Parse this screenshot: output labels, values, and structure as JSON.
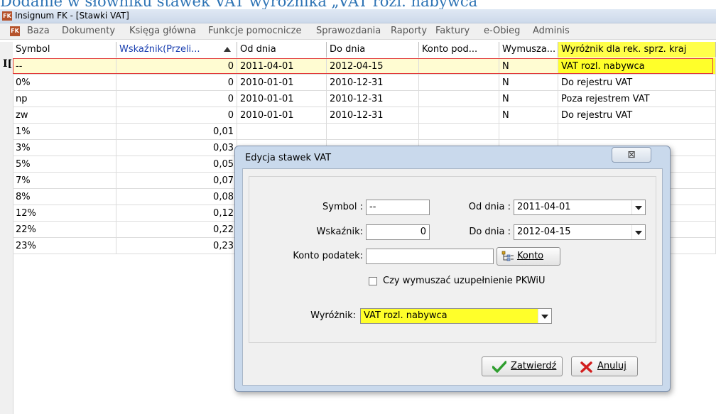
{
  "caption": "Dodanie w słowniku stawek VAT wyróżnika „VAT rozl. nabywca”",
  "window": {
    "title": "Insignum FK - [Stawki VAT]",
    "icon": "FK"
  },
  "menu": {
    "icon": "FK",
    "items": [
      "Baza",
      "Dokumenty",
      "Księga główna",
      "Funkcje pomocnicze",
      "Sprawozdania",
      "Raporty",
      "Faktury",
      "e-Obieg",
      "Adminis"
    ]
  },
  "grid": {
    "columns": [
      "Symbol",
      "Wskaźnik(Przeli...",
      "Od dnia",
      "Do dnia",
      "Konto pod...",
      "Wymusza...",
      "Wyróżnik dla rek. sprz. kraj"
    ],
    "rows": [
      [
        "--",
        "0",
        "2011-04-01",
        "2012-04-15",
        "",
        "N",
        "VAT rozl. nabywca"
      ],
      [
        "0%",
        "0",
        "2010-01-01",
        "2010-12-31",
        "",
        "N",
        "Do rejestru VAT"
      ],
      [
        "np",
        "0",
        "2010-01-01",
        "2010-12-31",
        "",
        "N",
        "Poza rejestrem VAT"
      ],
      [
        "zw",
        "0",
        "2010-01-01",
        "2010-12-31",
        "",
        "N",
        "Do rejestru VAT"
      ],
      [
        "1%",
        "0,01",
        "",
        "",
        "",
        "",
        ""
      ],
      [
        "3%",
        "0,03",
        "",
        "",
        "",
        "",
        ""
      ],
      [
        "5%",
        "0,05",
        "",
        "",
        "",
        "",
        ""
      ],
      [
        "7%",
        "0,07",
        "",
        "",
        "",
        "",
        ""
      ],
      [
        "8%",
        "0,08",
        "",
        "",
        "",
        "",
        ""
      ],
      [
        "12%",
        "0,12",
        "",
        "",
        "",
        "",
        ""
      ],
      [
        "22%",
        "0,22",
        "",
        "",
        "",
        "",
        ""
      ],
      [
        "23%",
        "0,23",
        "",
        "",
        "",
        "",
        ""
      ]
    ]
  },
  "dialog": {
    "title": "Edycja stawek VAT",
    "close": "⊠",
    "symbol_label": "Symbol :",
    "symbol_value": "--",
    "od_label": "Od dnia :",
    "od_value": "2011-04-01",
    "wsk_label": "Wskaźnik:",
    "wsk_value": "0",
    "do_label": "Do dnia :",
    "do_value": "2012-04-15",
    "konto_label": "Konto podatek:",
    "konto_value": "",
    "konto_btn": "Konto",
    "checkbox_label": "Czy wymuszać uzupełnienie PKWiU",
    "checkbox_checked": false,
    "wyroznik_label": "Wyróżnik:",
    "wyroznik_value": "VAT rozl. nabywca",
    "ok_btn": "Zatwierdź",
    "cancel_btn": "Anuluj"
  },
  "colors": {
    "highlight": "#ffff2a",
    "selection_border": "#e23a3a",
    "ok_icon": "#2f9e2f",
    "cancel_icon": "#d21e1e"
  }
}
